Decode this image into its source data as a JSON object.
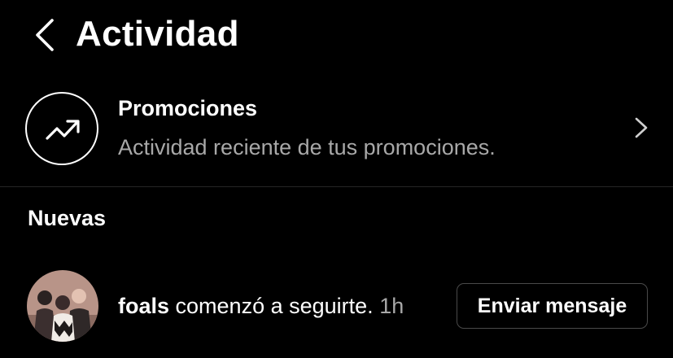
{
  "header": {
    "back_icon": "chevron-left-icon",
    "title": "Actividad"
  },
  "promotions": {
    "icon": "trending-up-icon",
    "title": "Promociones",
    "subtitle": "Actividad reciente de tus promociones.",
    "chevron_icon": "chevron-right-icon"
  },
  "sections": {
    "new_title": "Nuevas"
  },
  "activity": {
    "items": [
      {
        "username": "foals",
        "action": " comenzó a seguirte.",
        "time": "1h",
        "button_label": "Enviar mensaje"
      }
    ]
  },
  "colors": {
    "background": "#000000",
    "text_primary": "#ffffff",
    "text_secondary": "#a8a8a8",
    "divider": "#262626",
    "button_border": "#4a4a4a"
  }
}
